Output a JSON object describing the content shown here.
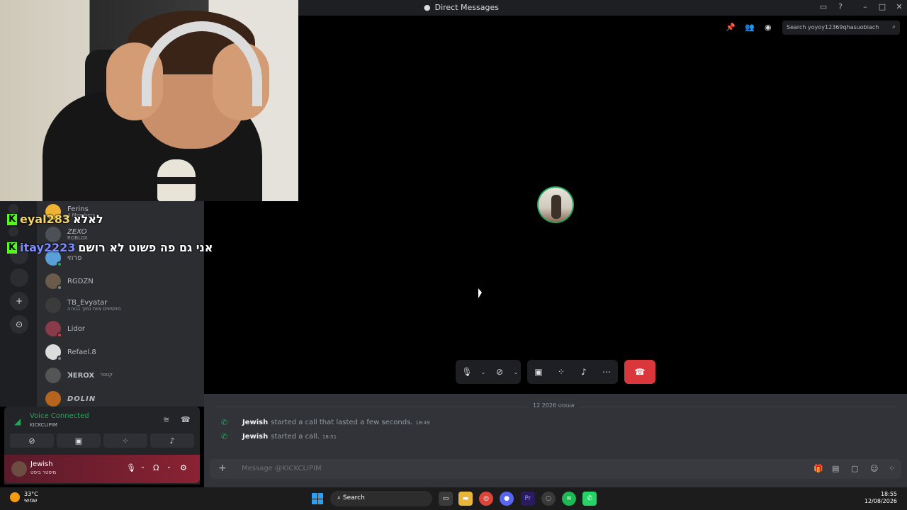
{
  "window": {
    "title": "Direct Messages"
  },
  "search": {
    "placeholder": "Search yoyoy12369qhasuobiach"
  },
  "dm_list": [
    {
      "name": "Ferins",
      "sub": "4 Members"
    },
    {
      "name": "ZEXO",
      "sub": "ROBLOX"
    },
    {
      "name": "פרוזי",
      "sub": ""
    },
    {
      "name": "RGDZN",
      "sub": ""
    },
    {
      "name": "TB_Evyatar",
      "sub": "מחפשים צוות נמוך גבוהה"
    },
    {
      "name": "Lidor",
      "sub": ""
    },
    {
      "name": "Refael.8",
      "sub": ""
    },
    {
      "name": "ꓘЕROX",
      "sub": "קטפר"
    },
    {
      "name": "DOLIN",
      "sub": ""
    }
  ],
  "overlay_chat": [
    {
      "user": "eyal283",
      "message": "לאלא"
    },
    {
      "user": "itay2223",
      "message": "אני גם פה פשוט לא רושם"
    }
  ],
  "voice": {
    "title": "Voice Connected",
    "channel": "KICKCLIPIM"
  },
  "user": {
    "name": "Jewish",
    "status": "מיסטר ביסט"
  },
  "chat": {
    "date": "12 אוגוסט 2026",
    "messages": [
      {
        "who": "Jewish",
        "text": "started a call that lasted a few seconds.",
        "time": "18:49"
      },
      {
        "who": "Jewish",
        "text": "started a call.",
        "time": "18:51"
      }
    ],
    "composer_placeholder": "Message @KICKCLIPIM"
  },
  "taskbar": {
    "temp": "33°C",
    "weather": "שמשי",
    "search": "Search",
    "time": "18:55",
    "date": "12/08/2026",
    "whatsapp_badge": "99+"
  },
  "colors": {
    "accent_green": "#23a55a",
    "hangup_red": "#da373c",
    "kick_green": "#53fc18"
  }
}
